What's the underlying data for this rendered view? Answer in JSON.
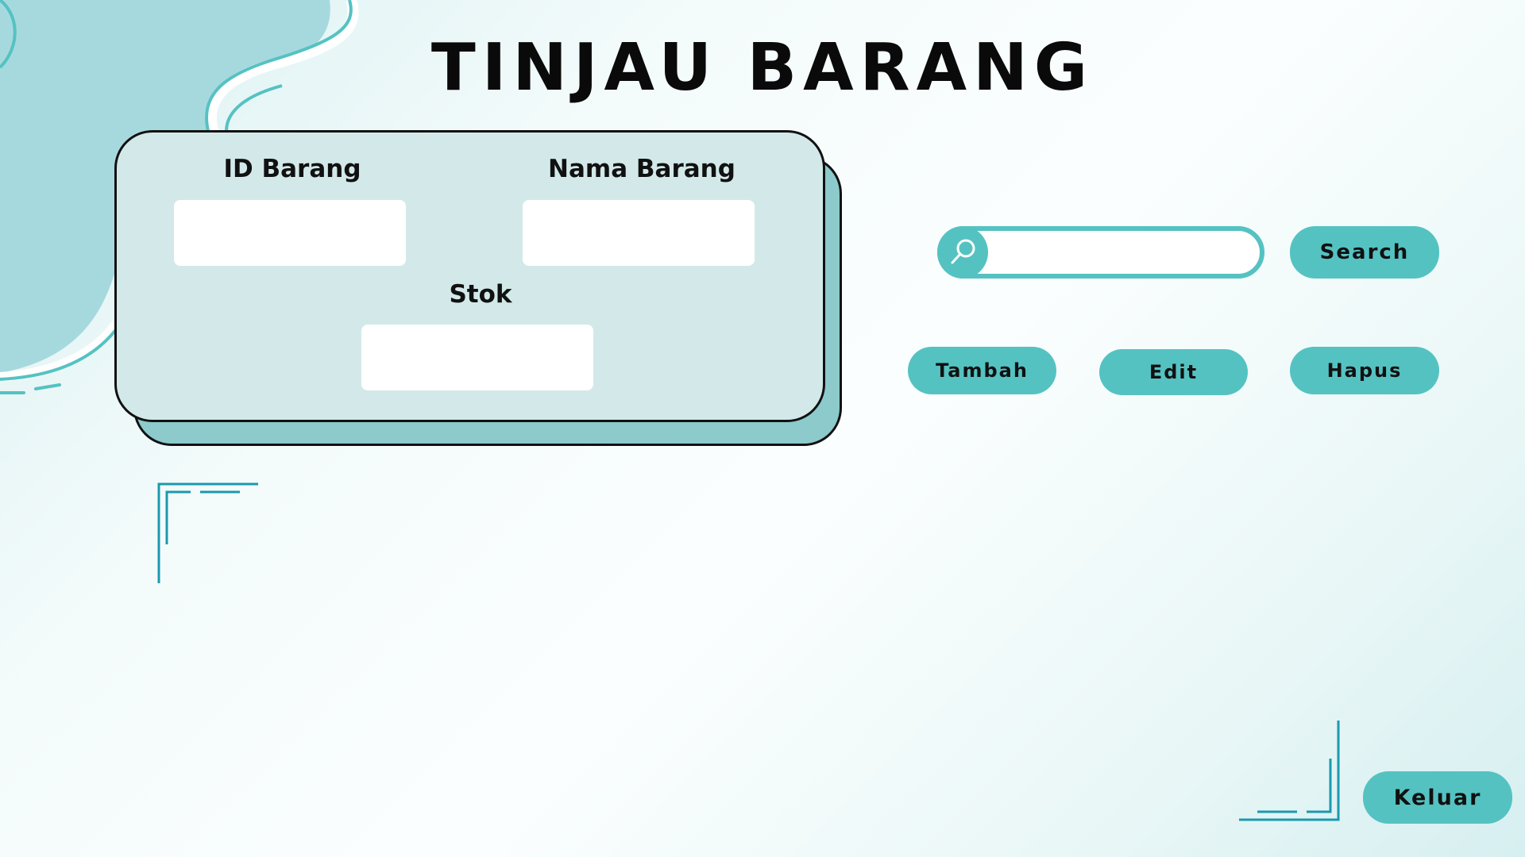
{
  "title": "TINJAU BARANG",
  "form": {
    "id_label": "ID Barang",
    "nama_label": "Nama Barang",
    "stok_label": "Stok",
    "id_value": "",
    "nama_value": "",
    "stok_value": ""
  },
  "search": {
    "value": "",
    "icon": "search-icon",
    "button_label": "Search"
  },
  "actions": {
    "tambah_label": "Tambah",
    "edit_label": "Edit",
    "hapus_label": "Hapus",
    "keluar_label": "Keluar"
  },
  "colors": {
    "accent": "#55c2c2",
    "card_bg": "#d3e9e9",
    "card_shadow": "#8ccacc",
    "blob": "#a6d9de",
    "frame_line": "#1a9aae",
    "text": "#111111"
  }
}
